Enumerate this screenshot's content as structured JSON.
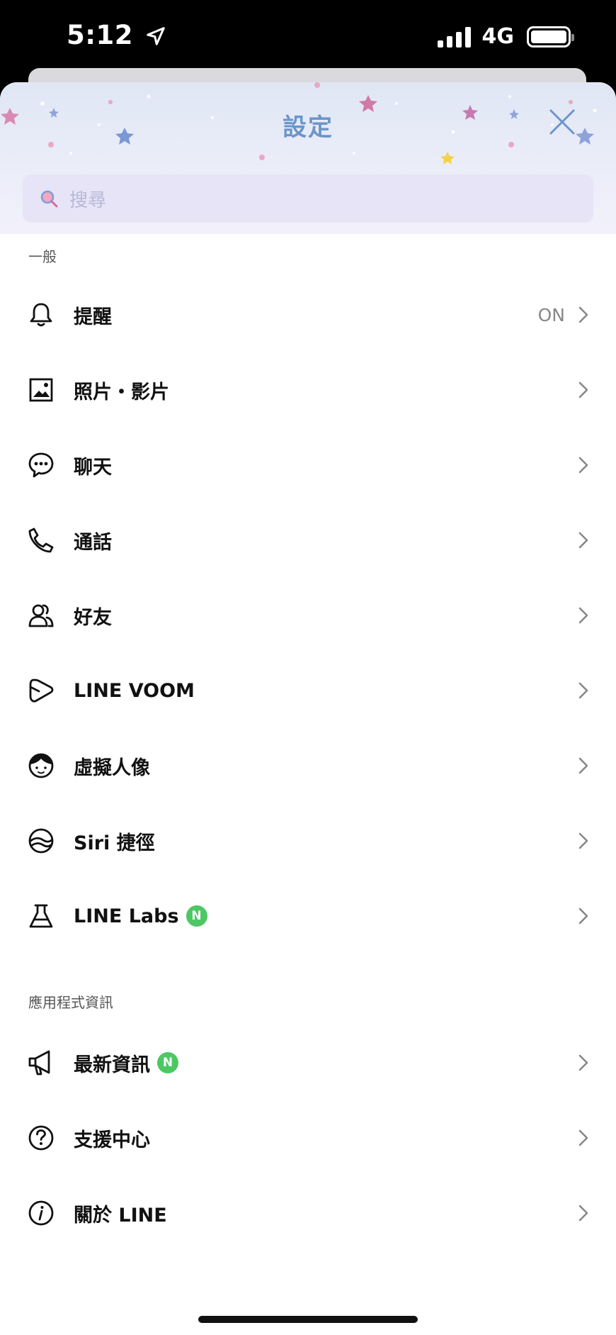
{
  "status_bar": {
    "time": "5:12",
    "network": "4G"
  },
  "header": {
    "title": "設定",
    "search_placeholder": "搜尋"
  },
  "sections": {
    "general": {
      "label": "一般",
      "items": [
        {
          "label": "提醒",
          "value": "ON",
          "icon": "bell-icon"
        },
        {
          "label": "照片・影片",
          "icon": "photo-icon"
        },
        {
          "label": "聊天",
          "icon": "chat-icon"
        },
        {
          "label": "通話",
          "icon": "phone-icon"
        },
        {
          "label": "好友",
          "icon": "friends-icon"
        },
        {
          "label": "LINE VOOM",
          "icon": "voom-icon"
        },
        {
          "label": "虛擬人像",
          "icon": "avatar-icon"
        },
        {
          "label": "Siri 捷徑",
          "icon": "siri-shortcut-icon"
        },
        {
          "label": "LINE Labs",
          "badge": "N",
          "icon": "flask-icon"
        }
      ]
    },
    "app_info": {
      "label": "應用程式資訊",
      "items": [
        {
          "label": "最新資訊",
          "badge": "N",
          "icon": "megaphone-icon"
        },
        {
          "label": "支援中心",
          "icon": "help-icon"
        },
        {
          "label": "關於 LINE",
          "icon": "info-icon"
        }
      ]
    }
  },
  "colors": {
    "title": "#6b95c9",
    "badge": "#4cc764",
    "search_bg": "#e6e4f6"
  }
}
